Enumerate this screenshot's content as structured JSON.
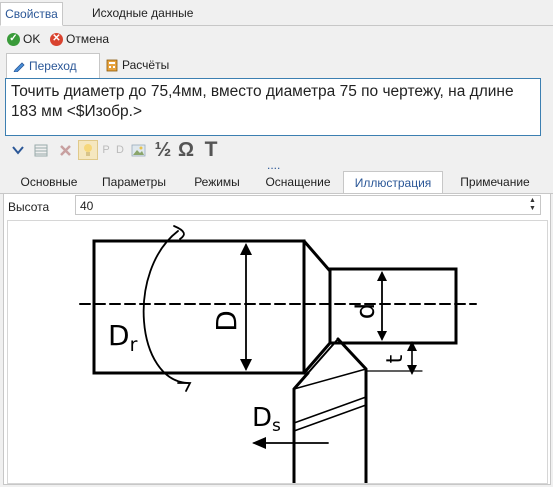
{
  "top_tabs": [
    "Свойства",
    "Исходные данные"
  ],
  "toolbar": {
    "ok_label": "OK",
    "cancel_label": "Отмена"
  },
  "sub_tabs": [
    "Переход",
    "Расчёты"
  ],
  "transition_text": "Точить диаметр до 75,4мм, вместо диаметра 75 по чертежу, на длине 183 мм  <$Изобр.>",
  "format_icons": {
    "p_label": "P",
    "d_label": "D",
    "half_label": "½",
    "omega_label": "Ω",
    "t_label": "T"
  },
  "more_dots": "....",
  "property_tabs": [
    "Основные",
    "Параметры",
    "Режимы",
    "Оснащение",
    "Иллюстрация",
    "Примечание"
  ],
  "active_property_tab": "Иллюстрация",
  "height_field": {
    "label": "Высота",
    "value": "40"
  },
  "drawing": {
    "label_D": "D",
    "label_d": "d",
    "label_t": "t",
    "label_Dr": "D",
    "label_Dr_sub": "r",
    "label_Ds": "D",
    "label_Ds_sub": "s"
  },
  "colors": {
    "accent": "#2b5797",
    "ok_green": "#3a9b3a",
    "cancel_red": "#d9432f",
    "border": "#c7c7c7"
  }
}
